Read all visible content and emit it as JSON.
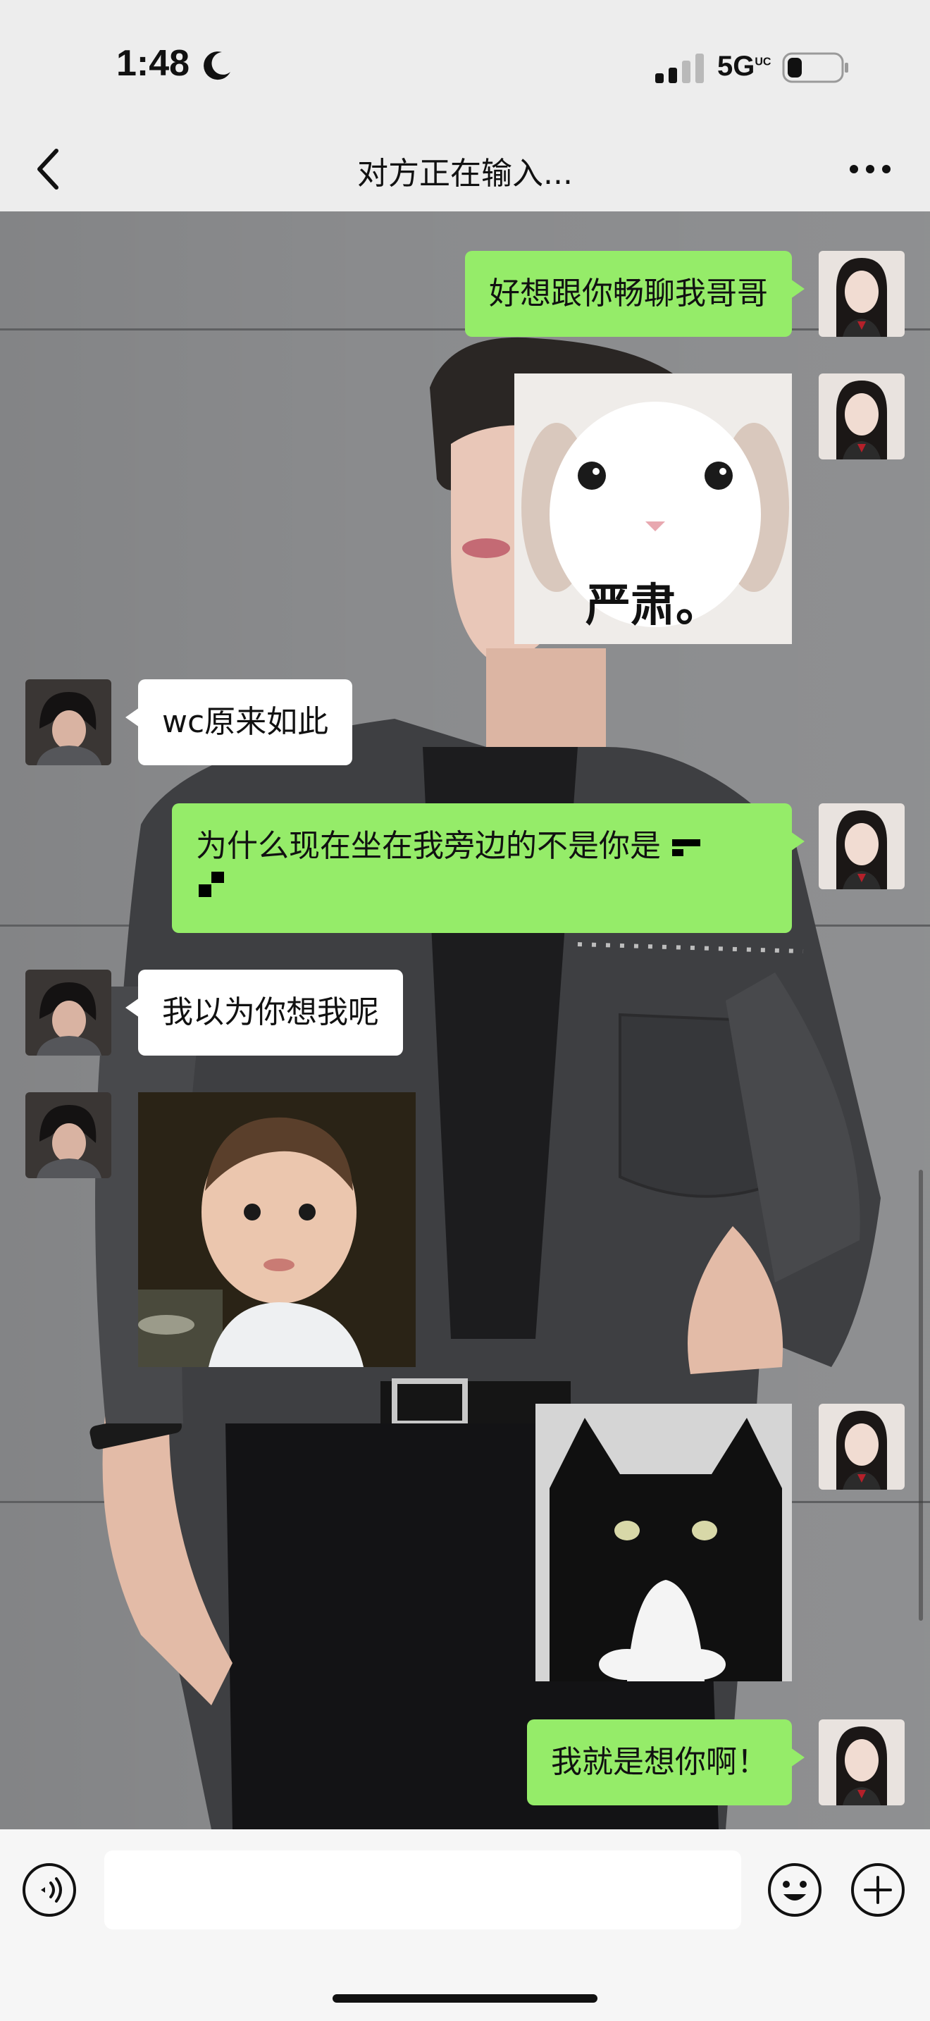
{
  "status_bar": {
    "time": "1:48",
    "network": "5G",
    "network_superscript": "UC",
    "icons": [
      "moon-icon",
      "signal-icon",
      "battery-icon"
    ]
  },
  "nav": {
    "title": "对方正在输入...",
    "icons": [
      "chevron-left-icon",
      "more-icon"
    ]
  },
  "messages": [
    {
      "sender": "me",
      "type": "text",
      "text": "好想跟你畅聊我哥哥"
    },
    {
      "sender": "me",
      "type": "sticker",
      "caption": "严肃。",
      "subject": "white rabbit"
    },
    {
      "sender": "other",
      "type": "text",
      "text": "wc原来如此"
    },
    {
      "sender": "me",
      "type": "text",
      "text": "为什么现在坐在我旁边的不是你是",
      "trailing": "pixel glyphs"
    },
    {
      "sender": "other",
      "type": "text",
      "text": "我以为你想我呢"
    },
    {
      "sender": "other",
      "type": "sticker",
      "caption": "",
      "subject": "toddler photo"
    },
    {
      "sender": "me",
      "type": "sticker",
      "caption": "",
      "subject": "black and white cat"
    },
    {
      "sender": "me",
      "type": "text",
      "text": "我就是想你啊！"
    }
  ],
  "input_bar": {
    "value": "",
    "icons": [
      "voice-icon",
      "emoji-icon",
      "plus-icon"
    ]
  },
  "colors": {
    "my_bubble": "#95ec69",
    "their_bubble": "#ffffff",
    "bar_background": "#ededed",
    "chat_background": "#8a8b8d"
  }
}
